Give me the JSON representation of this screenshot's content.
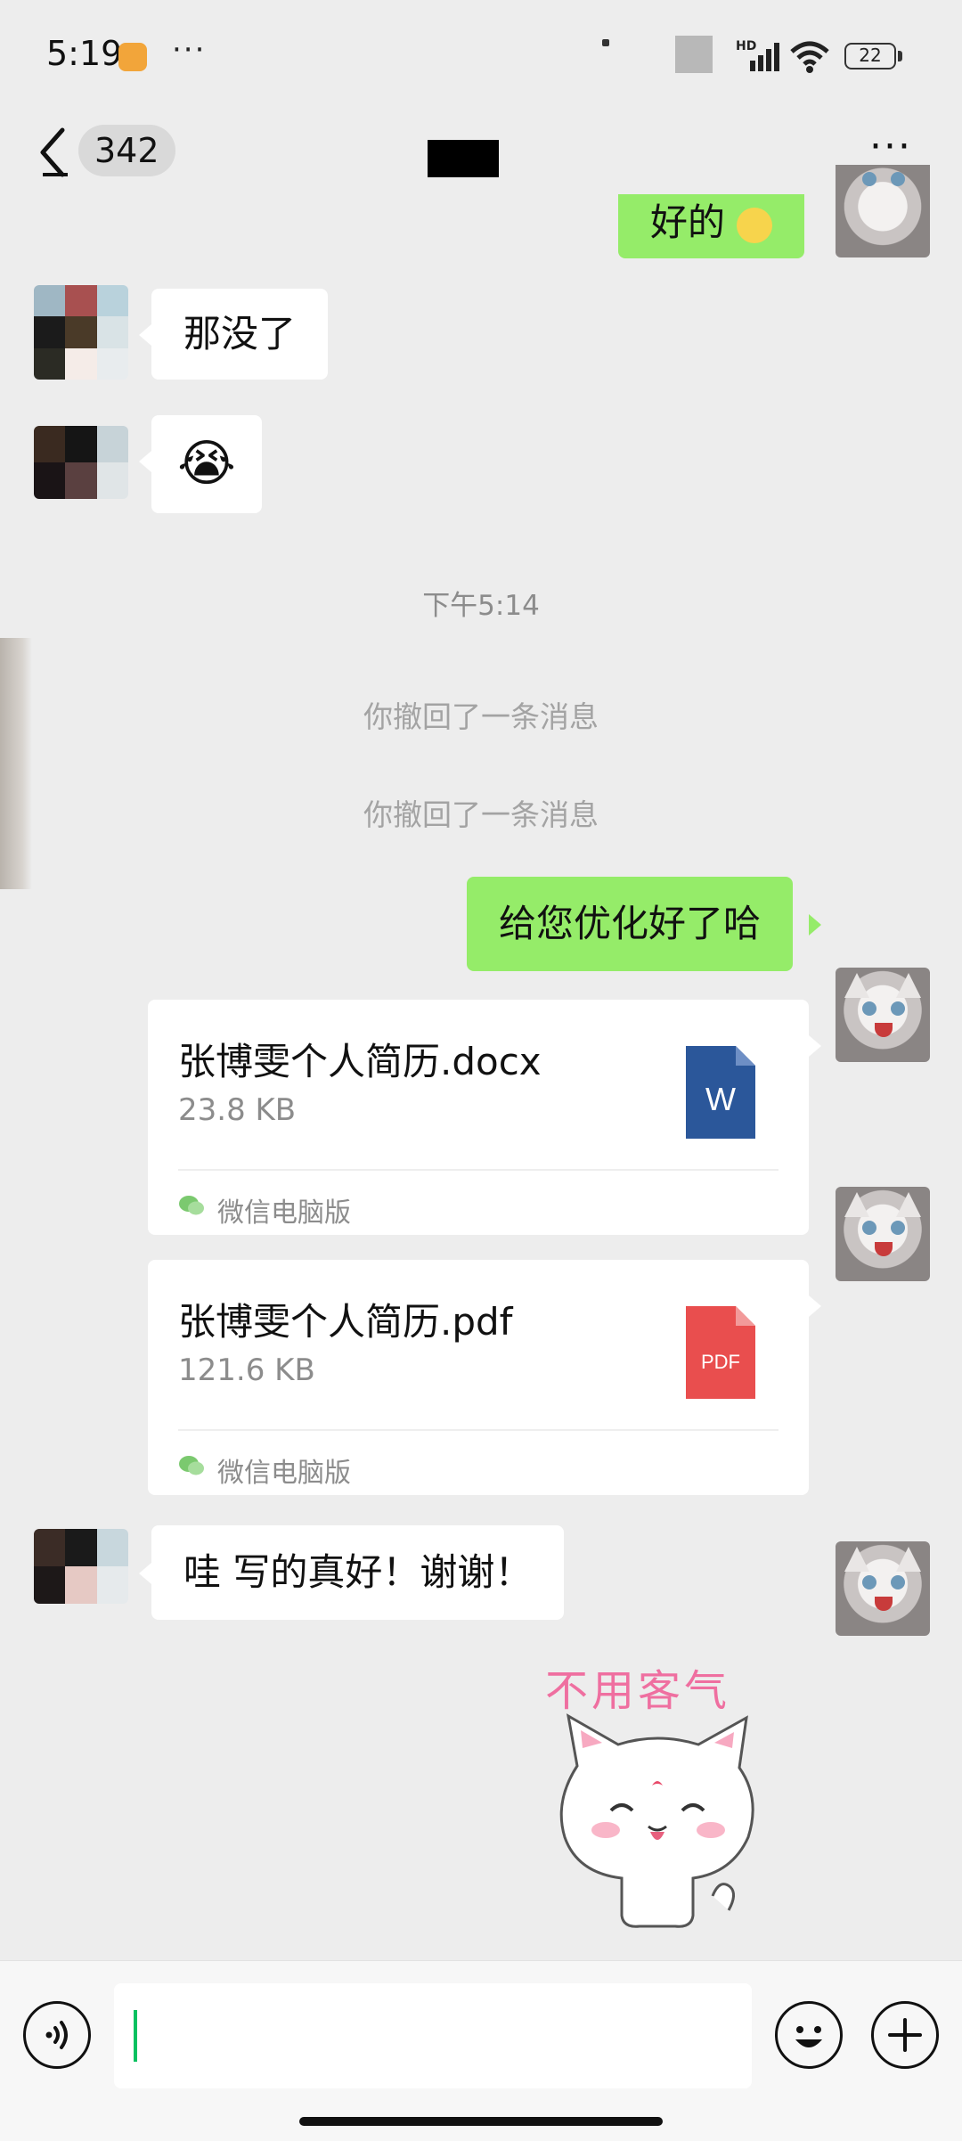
{
  "status_bar": {
    "time": "5:19",
    "more": "···",
    "network": "HD",
    "battery": "22"
  },
  "header": {
    "back_icon": "chevron-left-icon",
    "unread_count": "342",
    "more_icon": "more-horizontal-icon"
  },
  "messages": {
    "top_partial": "好的",
    "left_1": "那没了",
    "left_2_emoji": "😭",
    "timestamp": "下午5:14",
    "system_1": "你撤回了一条消息",
    "system_2": "你撤回了一条消息",
    "right_1": "给您优化好了哈",
    "file_1": {
      "name": "张博雯个人简历.docx",
      "size": "23.8 KB",
      "source": "微信电脑版",
      "icon_label": "W",
      "icon_color": "#2b579a"
    },
    "file_2": {
      "name": "张博雯个人简历.pdf",
      "size": "121.6 KB",
      "source": "微信电脑版",
      "icon_label": "PDF",
      "icon_color": "#e94e4e"
    },
    "left_3": "哇 写的真好！谢谢！",
    "sticker_text": "不用客气"
  },
  "colors": {
    "background": "#ededed",
    "bubble_self": "#95ec69",
    "bubble_other": "#ffffff",
    "caret": "#07c160"
  },
  "input_bar": {
    "voice_icon": "voice-icon",
    "emoji_icon": "emoji-icon",
    "plus_icon": "plus-icon"
  }
}
